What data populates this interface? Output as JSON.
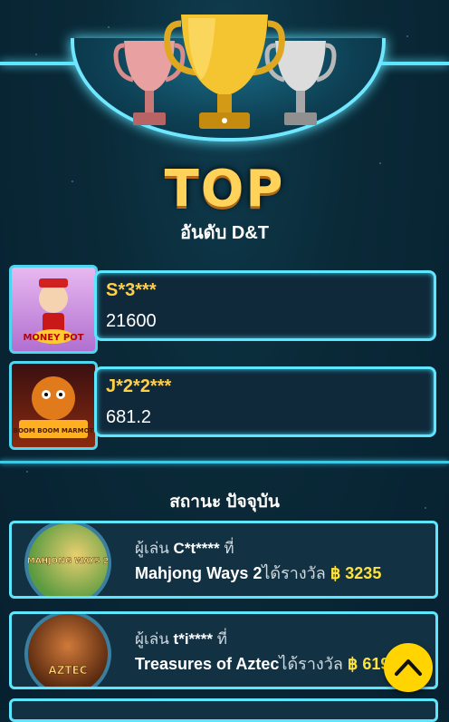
{
  "header": {
    "title": "TOP",
    "subtitle": "อันดับ D&T"
  },
  "ranking": [
    {
      "name": "S*3***",
      "score": "21600",
      "game_icon": "money-pot-icon",
      "game_logo_text": "MONEY POT"
    },
    {
      "name": "J*2*2***",
      "score": "681.2",
      "game_icon": "marmot-icon",
      "game_logo_text": "BOOM BOOM MARMOT"
    }
  ],
  "status": {
    "title": "สถานะ ปัจจุบัน",
    "feed": [
      {
        "prefix": "ผู้เล่น",
        "player": "C*t****",
        "at": "ที่",
        "game": "Mahjong Ways 2",
        "won": "ได้รางวัล",
        "amount": "฿ 3235",
        "game_icon": "mahjong-ways-icon",
        "game_logo_text": "MAHJONG WAYS 2"
      },
      {
        "prefix": "ผู้เล่น",
        "player": "t*i****",
        "at": "ที่",
        "game": "Treasures of Aztec",
        "won": "ได้รางวัล",
        "amount": "฿ 619",
        "game_icon": "aztec-icon",
        "game_logo_text": "AZTEC"
      }
    ]
  },
  "colors": {
    "accent": "#5fe6ff",
    "gold": "#ffcf45",
    "amount": "#ffe23a",
    "fab": "#ffd400"
  },
  "scroll_top_icon": "chevron-up-icon"
}
